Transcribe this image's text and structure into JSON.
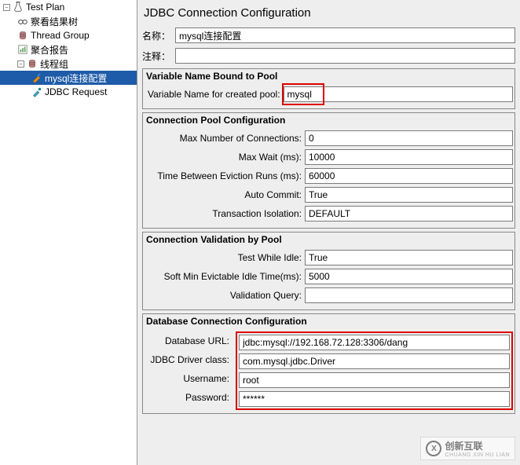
{
  "tree": {
    "root": "Test Plan",
    "items": [
      {
        "label": "察看结果树",
        "indent": 1
      },
      {
        "label": "Thread Group",
        "indent": 1
      },
      {
        "label": "聚合报告",
        "indent": 1
      },
      {
        "label": "线程组",
        "indent": 1,
        "expandable": true
      },
      {
        "label": "mysql连接配置",
        "indent": 2,
        "selected": true
      },
      {
        "label": "JDBC Request",
        "indent": 2
      }
    ]
  },
  "page": {
    "title": "JDBC Connection Configuration",
    "name_label": "名称：",
    "name_value": "mysql连接配置",
    "comment_label": "注释：",
    "comment_value": ""
  },
  "sections": {
    "var_pool": {
      "title": "Variable Name Bound to Pool",
      "label": "Variable Name for created pool:",
      "value": "mysql"
    },
    "pool_conf": {
      "title": "Connection Pool Configuration",
      "rows": [
        {
          "label": "Max Number of Connections:",
          "value": "0"
        },
        {
          "label": "Max Wait (ms):",
          "value": "10000"
        },
        {
          "label": "Time Between Eviction Runs (ms):",
          "value": "60000"
        },
        {
          "label": "Auto Commit:",
          "value": "True"
        },
        {
          "label": "Transaction Isolation:",
          "value": "DEFAULT"
        }
      ]
    },
    "validation": {
      "title": "Connection Validation by Pool",
      "rows": [
        {
          "label": "Test While Idle:",
          "value": "True"
        },
        {
          "label": "Soft Min Evictable Idle Time(ms):",
          "value": "5000"
        },
        {
          "label": "Validation Query:",
          "value": ""
        }
      ]
    },
    "db_conf": {
      "title": "Database Connection Configuration",
      "rows": [
        {
          "label": "Database URL:",
          "value": "jdbc:mysql://192.168.72.128:3306/dang"
        },
        {
          "label": "JDBC Driver class:",
          "value": "com.mysql.jdbc.Driver"
        },
        {
          "label": "Username:",
          "value": "root"
        },
        {
          "label": "Password:",
          "value": "******"
        }
      ]
    }
  },
  "watermark": {
    "logo": "X",
    "text": "创新互联",
    "sub": "CHUANG XIN HU LIAN"
  }
}
